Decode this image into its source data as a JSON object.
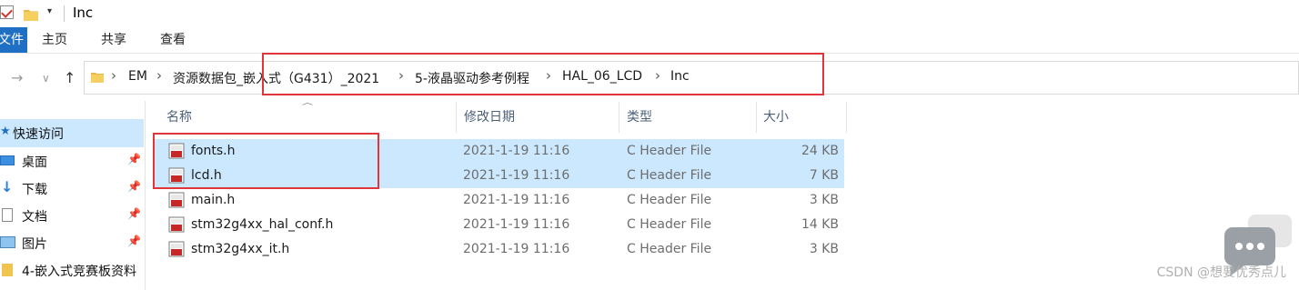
{
  "window": {
    "title": "Inc"
  },
  "ribbon": {
    "file_tab": "文件",
    "tabs": [
      "主页",
      "共享",
      "查看"
    ]
  },
  "address": {
    "crumbs": [
      "EM",
      "资源数据包_嵌入式（G431）_2021",
      "5-液晶驱动参考例程",
      "HAL_06_LCD",
      "Inc"
    ]
  },
  "sidebar": {
    "items": [
      {
        "label": "快速访问",
        "icon": "star-icon",
        "pinned": false
      },
      {
        "label": "桌面",
        "icon": "desktop-icon",
        "pinned": true
      },
      {
        "label": "下载",
        "icon": "download-icon",
        "pinned": true
      },
      {
        "label": "文档",
        "icon": "document-icon",
        "pinned": true
      },
      {
        "label": "图片",
        "icon": "pictures-icon",
        "pinned": true
      },
      {
        "label": "4-嵌入式竞赛板资料",
        "icon": "folder-icon",
        "pinned": false
      }
    ]
  },
  "columns": {
    "name": "名称",
    "modified": "修改日期",
    "type": "类型",
    "size": "大小"
  },
  "files": [
    {
      "name": "fonts.h",
      "modified": "2021-1-19 11:16",
      "type": "C Header File",
      "size": "24 KB",
      "selected": true
    },
    {
      "name": "lcd.h",
      "modified": "2021-1-19 11:16",
      "type": "C Header File",
      "size": "7 KB",
      "selected": true
    },
    {
      "name": "main.h",
      "modified": "2021-1-19 11:16",
      "type": "C Header File",
      "size": "3 KB",
      "selected": false
    },
    {
      "name": "stm32g4xx_hal_conf.h",
      "modified": "2021-1-19 11:16",
      "type": "C Header File",
      "size": "14 KB",
      "selected": false
    },
    {
      "name": "stm32g4xx_it.h",
      "modified": "2021-1-19 11:16",
      "type": "C Header File",
      "size": "3 KB",
      "selected": false
    }
  ],
  "watermark": "CSDN @想要优秀点儿",
  "colors": {
    "selection": "#cce8ff",
    "accent": "#1f6fc5",
    "highlight_box": "#e0353b"
  }
}
